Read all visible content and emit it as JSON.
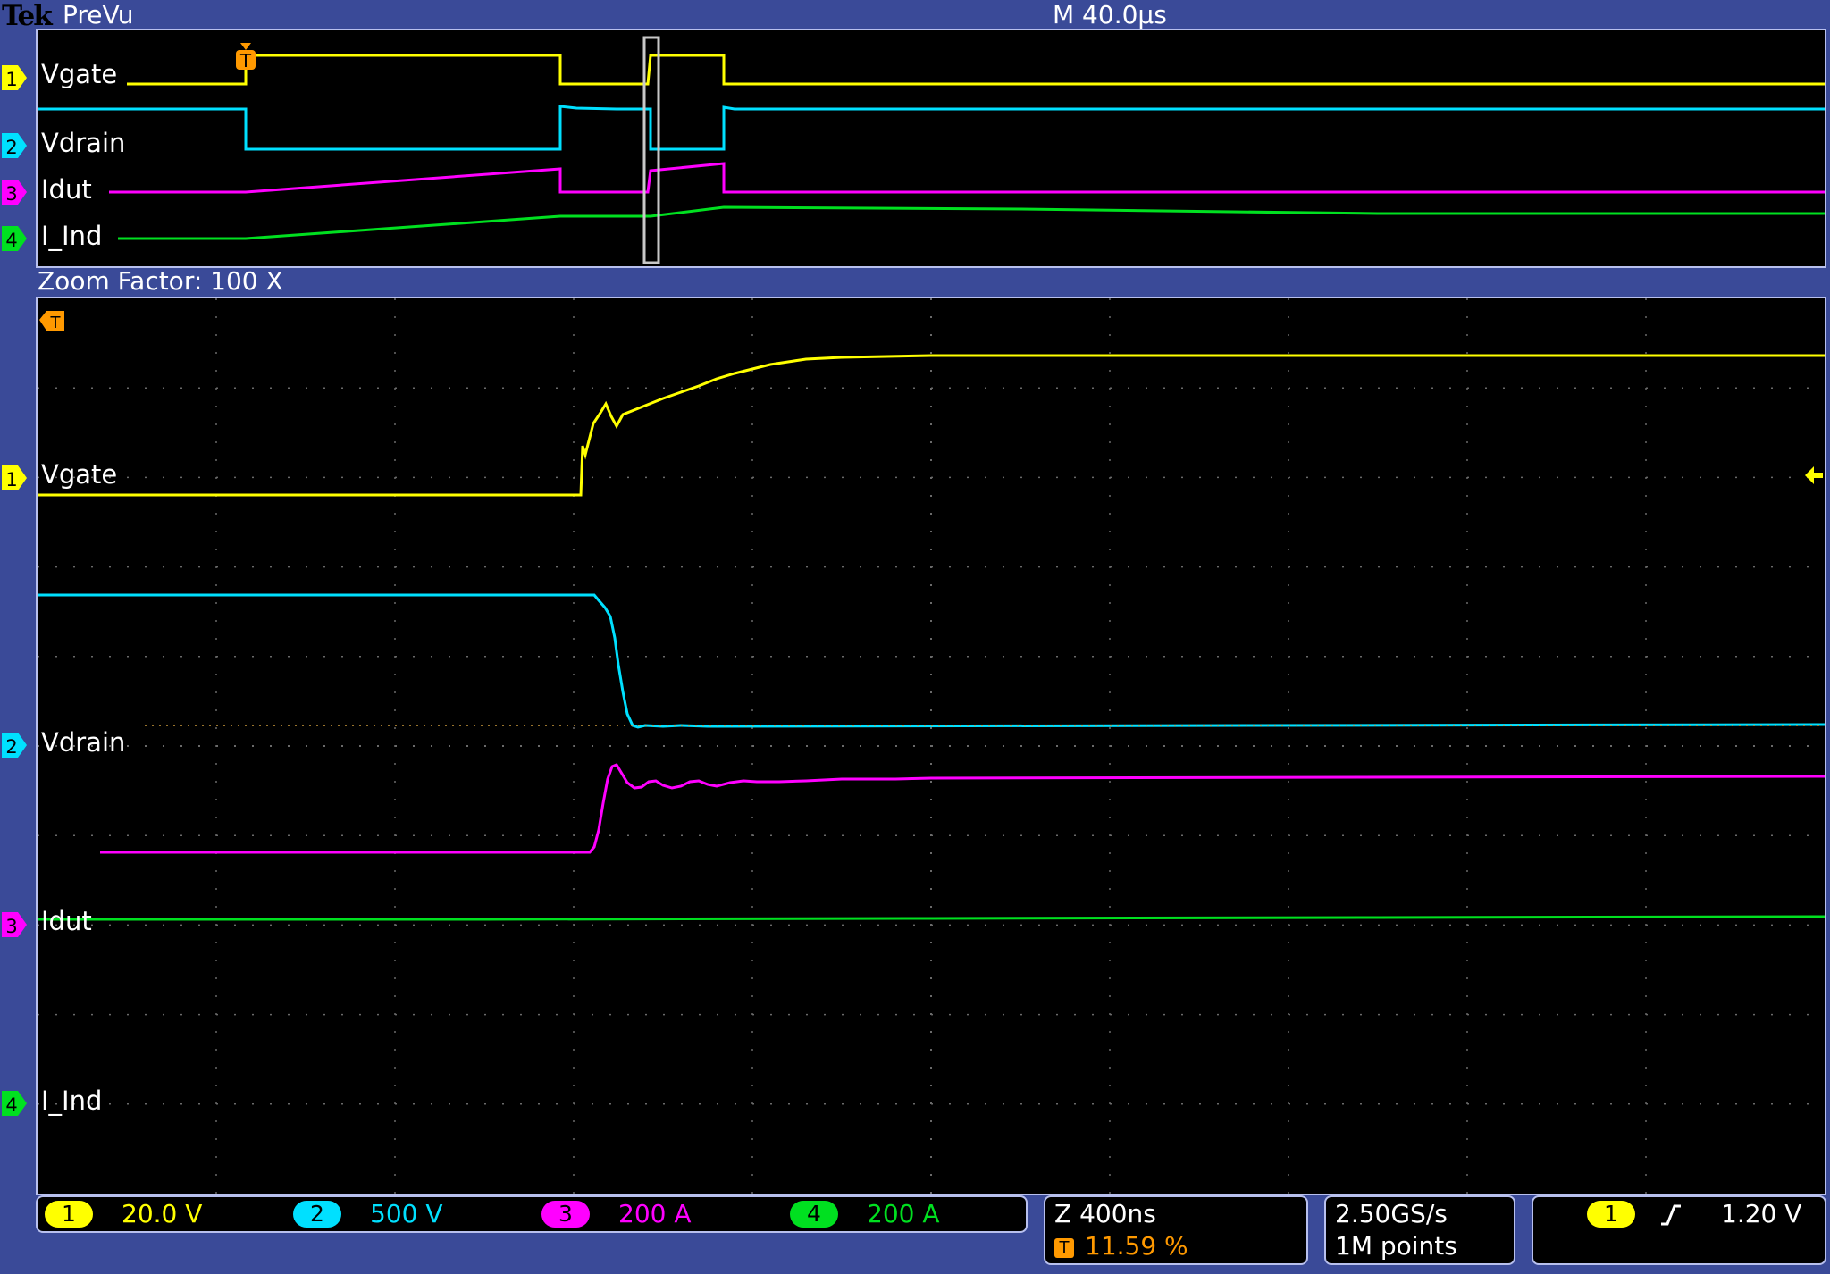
{
  "header": {
    "brand": "Tek",
    "status": "PreVu",
    "timebase": "M 40.0µs",
    "zoom_label": "Zoom Factor: 100 X"
  },
  "colors": {
    "ch1": "#ffff00",
    "ch2": "#00e0ff",
    "ch3": "#ff00ff",
    "ch4": "#00e020",
    "trigger": "#ff9900",
    "frame": "#3a4a98"
  },
  "channels": [
    {
      "num": "1",
      "name": "Vgate",
      "scale": "20.0 V"
    },
    {
      "num": "2",
      "name": "Vdrain",
      "scale": "500 V"
    },
    {
      "num": "3",
      "name": "Idut",
      "scale": "200 A"
    },
    {
      "num": "4",
      "name": "I_Ind",
      "scale": "200 A"
    }
  ],
  "trigger_marker": "T",
  "zoom_box": {
    "zoom_time": "Z 400ns",
    "trigger_position": "11.59 %"
  },
  "acquisition": {
    "sample_rate": "2.50GS/s",
    "record_length": "1M points"
  },
  "trigger": {
    "source": "1",
    "slope_icon": "rising-edge-icon",
    "level": "1.20 V"
  }
}
